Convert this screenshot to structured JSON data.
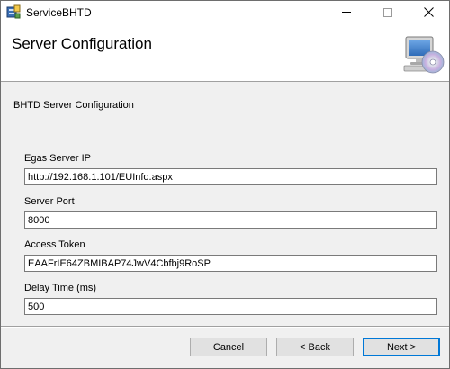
{
  "window": {
    "title": "ServiceBHTD",
    "icon": "installer-app-icon",
    "controls": [
      "minimize-icon",
      "maximize-icon",
      "close-icon"
    ]
  },
  "banner": {
    "title": "Server Configuration",
    "icon": "computer-cd-icon"
  },
  "section": {
    "title": "BHTD Server Configuration"
  },
  "fields": [
    {
      "label": "Egas Server IP",
      "value": "http://192.168.1.101/EUInfo.aspx"
    },
    {
      "label": "Server Port",
      "value": "8000"
    },
    {
      "label": "Access Token",
      "value": "EAAFrIE64ZBMIBAP74JwV4Cbfbj9RoSP"
    },
    {
      "label": "Delay Time (ms)",
      "value": "500"
    }
  ],
  "buttons": {
    "cancel": "Cancel",
    "back": "< Back",
    "next": "Next >"
  },
  "colors": {
    "dialog_bg": "#f0f0f0",
    "focus_border": "#0078d7"
  }
}
